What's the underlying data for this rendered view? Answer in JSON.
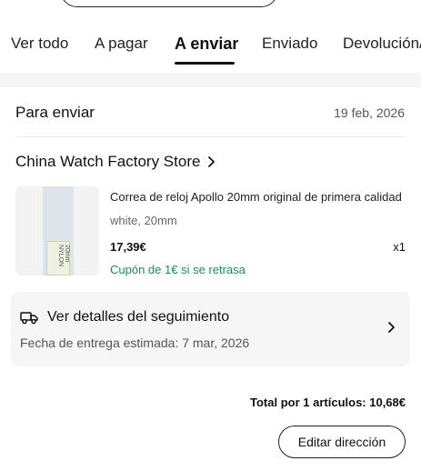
{
  "tabs": [
    {
      "label": "Ver todo",
      "active": false
    },
    {
      "label": "A pagar",
      "active": false
    },
    {
      "label": "A enviar",
      "active": true
    },
    {
      "label": "Enviado",
      "active": false
    },
    {
      "label": "Devolución/",
      "active": false
    }
  ],
  "order": {
    "status_label": "Para enviar",
    "date": "19 feb, 2026"
  },
  "store": {
    "name": "China Watch Factory Store",
    "chevron_icon": "chevron-right-icon"
  },
  "product": {
    "title": "Correa de reloj Apollo 20mm original de primera calidad",
    "variant": "white, 20mm",
    "price": "17,39€",
    "quantity": "x1",
    "coupon": "Cupón de 1€ si se retrasa",
    "image_icon": "watch-strap-image",
    "strap_text": "20mm NYLON"
  },
  "tracking": {
    "icon": "truck-icon",
    "title": "Ver detalles del seguimiento",
    "estimate": "Fecha de entrega estimada: 7 mar, 2026",
    "chevron_icon": "chevron-right-icon"
  },
  "summary": {
    "total": "Total por 1 artículos: 10,68€"
  },
  "actions": {
    "edit_address": "Editar dirección"
  },
  "colors": {
    "coupon_green": "#1a8f52",
    "background_strip": "#f5f5f5",
    "card_background": "#f6f6f6"
  }
}
